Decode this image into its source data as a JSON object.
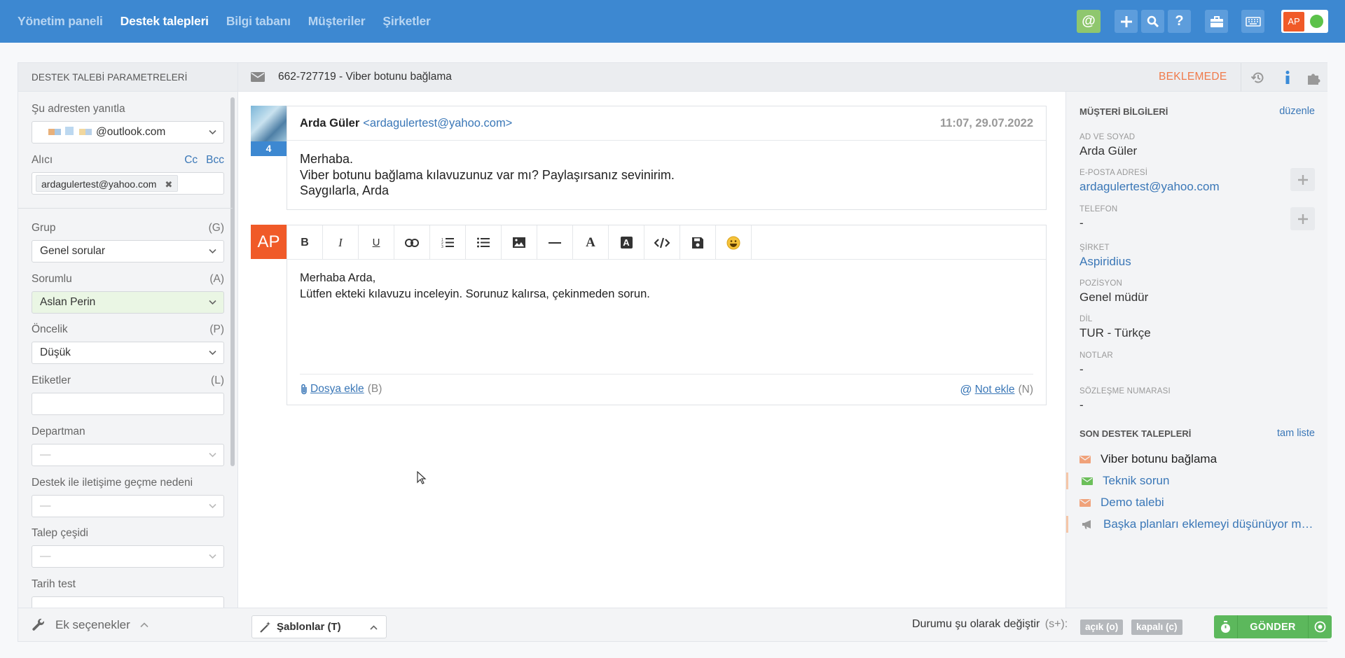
{
  "nav": {
    "items": [
      "Yönetim paneli",
      "Destek talepleri",
      "Bilgi tabanı",
      "Müşteriler",
      "Şirketler"
    ],
    "active_index": 1
  },
  "topbar": {
    "mention_symbol": "@",
    "user_initials": "AP",
    "status_color": "#5cc24a",
    "icons": [
      "plus-icon",
      "search-icon",
      "question-icon",
      "briefcase-icon",
      "keyboard-icon"
    ]
  },
  "left_panel": {
    "title": "DESTEK TALEBİ PARAMETRELERİ",
    "reply_from": {
      "label": "Şu adresten yanıtla",
      "value": "@outlook.com"
    },
    "recipient": {
      "label": "Alıcı",
      "cc": "Cc",
      "bcc": "Bcc",
      "chip": "ardagulertest@yahoo.com",
      "remove": "✖"
    },
    "group": {
      "label": "Grup",
      "key": "(G)",
      "value": "Genel sorular"
    },
    "responsible": {
      "label": "Sorumlu",
      "key": "(A)",
      "value": "Aslan Perin"
    },
    "priority": {
      "label": "Öncelik",
      "key": "(P)",
      "value": "Düşük"
    },
    "tags": {
      "label": "Etiketler",
      "key": "(L)",
      "value": ""
    },
    "department": {
      "label": "Departman",
      "value": "—"
    },
    "contact_reason": {
      "label": "Destek ile iletişime geçme nedeni",
      "value": "—"
    },
    "request_type": {
      "label": "Talep çeşidi",
      "value": "—"
    },
    "date_test": {
      "label": "Tarih test"
    },
    "footer": "Ek seçenekler"
  },
  "ticket": {
    "subject": "662-727719 - Viber botunu bağlama",
    "status": "BEKLEMEDE",
    "status_color": "#f07a4a"
  },
  "message": {
    "author": "Arda Güler",
    "email": "<ardagulertest@yahoo.com>",
    "time": "11:07, 29.07.2022",
    "count_badge": "4",
    "lines": [
      "Merhaba.",
      "Viber botunu bağlama kılavuzunuz var mı? Paylaşırsanız sevinirim.",
      "Saygılarla, Arda"
    ]
  },
  "editor": {
    "initials": "AP",
    "lines": [
      "Merhaba Arda,",
      "Lütfen ekteki kılavuzu inceleyin. Sorunuz kalırsa, çekinmeden sorun."
    ],
    "attach_label": "Dosya ekle",
    "attach_key": "(B)",
    "note_label": "Not ekle",
    "note_key": "(N)",
    "toolbar": [
      "bold-icon",
      "italic-icon",
      "underline-icon",
      "link-icon",
      "ordered-list-icon",
      "bullet-list-icon",
      "image-icon",
      "horizontal-rule-icon",
      "font-icon",
      "font-color-icon",
      "code-icon",
      "save-icon",
      "emoji-icon"
    ]
  },
  "customer": {
    "title": "MÜŞTERİ BİLGİLERİ",
    "edit": "düzenle",
    "fields": {
      "name": {
        "label": "AD VE SOYAD",
        "value": "Arda Güler"
      },
      "email": {
        "label": "E-POSTA ADRESİ",
        "value": "ardagulertest@yahoo.com"
      },
      "phone": {
        "label": "TELEFON",
        "value": "-"
      },
      "company": {
        "label": "ŞİRKET",
        "value": "Aspiridius"
      },
      "position": {
        "label": "POZİSYON",
        "value": "Genel müdür"
      },
      "language": {
        "label": "DİL",
        "value": "TUR - Türkçe"
      },
      "notes": {
        "label": "NOTLAR",
        "value": "-"
      },
      "contract": {
        "label": "SÖZLEŞME NUMARASI",
        "value": "-"
      }
    },
    "recent": {
      "title": "SON DESTEK TALEPLERİ",
      "full_list": "tam liste",
      "items": [
        {
          "label": "Viber botunu bağlama",
          "icon_color": "#f0a27a"
        },
        {
          "label": "Teknik sorun",
          "icon_color": "#6cbf5a"
        },
        {
          "label": "Demo talebi",
          "icon_color": "#f0a27a"
        },
        {
          "label": "Başka planları eklemeyi düşünüyor m…",
          "icon_color": "#999999"
        }
      ]
    }
  },
  "bottom": {
    "templates": "Şablonlar (T)",
    "change_status": "Durumu şu olarak değiştir",
    "change_status_key": "(s+):",
    "open": "açık (o)",
    "closed": "kapalı (c)",
    "send": "GÖNDER",
    "send_color": "#5cb85c"
  }
}
